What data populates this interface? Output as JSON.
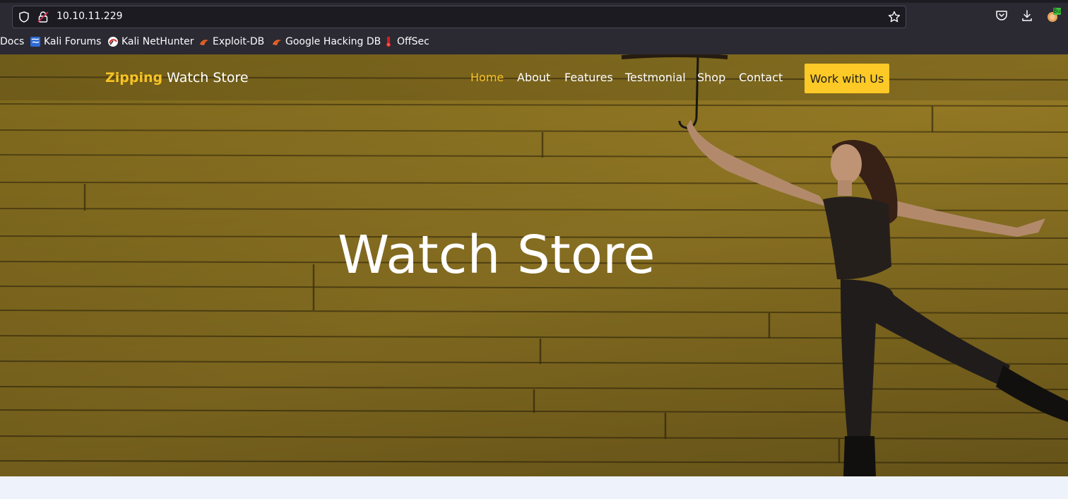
{
  "browser": {
    "url": "10.10.11.229",
    "bookmarks": [
      {
        "label": "Docs",
        "icon": "docs-icon"
      },
      {
        "label": "Kali Forums",
        "icon": "kali-forums-icon"
      },
      {
        "label": "Kali NetHunter",
        "icon": "kali-nethunter-icon"
      },
      {
        "label": "Exploit-DB",
        "icon": "exploit-db-icon"
      },
      {
        "label": "Google Hacking DB",
        "icon": "google-hacking-db-icon"
      },
      {
        "label": "OffSec",
        "icon": "offsec-icon"
      }
    ],
    "extension_badge": "Bur"
  },
  "site": {
    "brand_accent": "Zipping",
    "brand_rest": " Watch Store",
    "nav": [
      {
        "label": "Home",
        "active": true
      },
      {
        "label": "About"
      },
      {
        "label": "Features"
      },
      {
        "label": "Testmonial"
      },
      {
        "label": "Shop"
      },
      {
        "label": "Contact"
      }
    ],
    "cta_label": "Work with Us",
    "hero_title": "Watch Store"
  },
  "colors": {
    "accent": "#f7c325",
    "button": "#fcc926",
    "wall": "#a88a2a",
    "chrome": "#2b2a33"
  }
}
